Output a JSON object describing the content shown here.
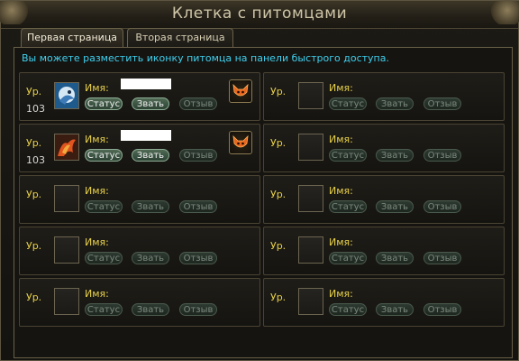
{
  "window": {
    "title": "Клетка с питомцами"
  },
  "tabs": [
    {
      "label": "Первая страница",
      "active": true
    },
    {
      "label": "Вторая страница",
      "active": false
    }
  ],
  "notice": "Вы можете разместить иконку питомца на панели быстрого доступа.",
  "labels": {
    "level": "Ур.",
    "name": "Имя:",
    "status": "Статус",
    "summon": "Звать",
    "recall": "Отзыв"
  },
  "slots": [
    {
      "level": "103",
      "pet_icon": "bird-pet-icon",
      "name_hidden": true,
      "status_enabled": true,
      "summon_enabled": true,
      "recall_enabled": false,
      "quick_icon": "fox-mask-icon"
    },
    {
      "level": "",
      "pet_icon": "",
      "name_hidden": false,
      "status_enabled": false,
      "summon_enabled": false,
      "recall_enabled": false,
      "quick_icon": ""
    },
    {
      "level": "103",
      "pet_icon": "phoenix-pet-icon",
      "name_hidden": true,
      "status_enabled": true,
      "summon_enabled": true,
      "recall_enabled": false,
      "quick_icon": "fox-mask-icon"
    },
    {
      "level": "",
      "pet_icon": "",
      "name_hidden": false,
      "status_enabled": false,
      "summon_enabled": false,
      "recall_enabled": false,
      "quick_icon": ""
    },
    {
      "level": "",
      "pet_icon": "",
      "name_hidden": false,
      "status_enabled": false,
      "summon_enabled": false,
      "recall_enabled": false,
      "quick_icon": ""
    },
    {
      "level": "",
      "pet_icon": "",
      "name_hidden": false,
      "status_enabled": false,
      "summon_enabled": false,
      "recall_enabled": false,
      "quick_icon": ""
    },
    {
      "level": "",
      "pet_icon": "",
      "name_hidden": false,
      "status_enabled": false,
      "summon_enabled": false,
      "recall_enabled": false,
      "quick_icon": ""
    },
    {
      "level": "",
      "pet_icon": "",
      "name_hidden": false,
      "status_enabled": false,
      "summon_enabled": false,
      "recall_enabled": false,
      "quick_icon": ""
    },
    {
      "level": "",
      "pet_icon": "",
      "name_hidden": false,
      "status_enabled": false,
      "summon_enabled": false,
      "recall_enabled": false,
      "quick_icon": ""
    },
    {
      "level": "",
      "pet_icon": "",
      "name_hidden": false,
      "status_enabled": false,
      "summon_enabled": false,
      "recall_enabled": false,
      "quick_icon": ""
    }
  ],
  "colors": {
    "label_yellow": "#e8d14a",
    "notice_cyan": "#3fd0ef",
    "button_green": "#4f6a55"
  }
}
